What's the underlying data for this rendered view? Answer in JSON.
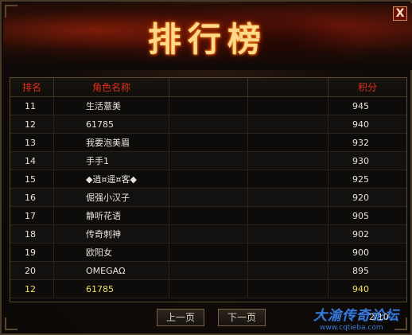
{
  "window": {
    "title": "排行榜",
    "close_label": "X"
  },
  "table": {
    "headers": [
      "排名",
      "角色名称",
      "",
      "",
      "积分"
    ],
    "rows": [
      {
        "rank": "11",
        "name": "生活薏美",
        "score": "945"
      },
      {
        "rank": "12",
        "name": "61785",
        "score": "940"
      },
      {
        "rank": "13",
        "name": "我要泡美眉",
        "score": "932"
      },
      {
        "rank": "14",
        "name": "手手1",
        "score": "930"
      },
      {
        "rank": "15",
        "name": "◆逍¤遥¤客◆",
        "score": "925"
      },
      {
        "rank": "16",
        "name": "倔强小汉子",
        "score": "920"
      },
      {
        "rank": "17",
        "name": "静听花语",
        "score": "905"
      },
      {
        "rank": "18",
        "name": "传奇刺神",
        "score": "902"
      },
      {
        "rank": "19",
        "name": "欧阳女",
        "score": "900"
      },
      {
        "rank": "20",
        "name": "OMEGAΩ",
        "score": "895"
      }
    ],
    "self_row": {
      "rank": "12",
      "name": "61785",
      "score": "940"
    }
  },
  "pagination": {
    "prev_label": "上一页",
    "next_label": "下一页",
    "page_text": "2/10"
  },
  "watermark": {
    "name": "大渝传奇论坛",
    "url": "www.cqtieba.com"
  },
  "colors": {
    "header_text": "#e0301a",
    "self_row_text": "#f0e060",
    "title": "#ffd98a"
  }
}
